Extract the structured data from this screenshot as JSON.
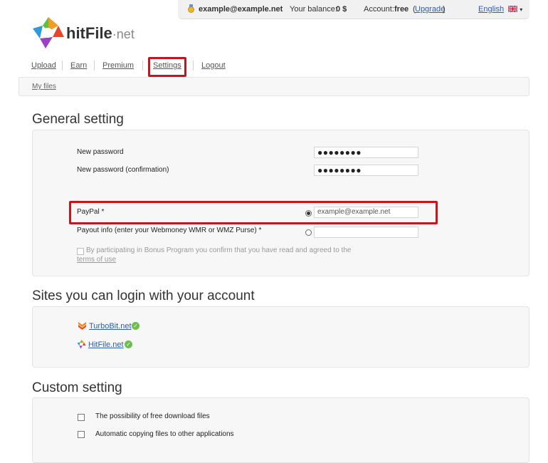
{
  "topbar": {
    "email": "example@example.net",
    "balance_label": "Your balance:",
    "balance_value": "0 $",
    "account_label": "Account:",
    "account_value": "free",
    "upgrade_prefix": "(",
    "upgrade_link": "Upgrade",
    "upgrade_suffix": ")",
    "language": "English",
    "colors": {
      "bar_bg": "#f1f1f1"
    }
  },
  "logo": {
    "text_a": "hit",
    "text_b": "File",
    "text_c": "·net"
  },
  "nav": {
    "items": [
      "Upload",
      "Earn",
      "Premium",
      "Settings",
      "Logout"
    ],
    "highlight_color": "#c4161c"
  },
  "breadcrumb": {
    "label": "My files"
  },
  "general": {
    "title": "General setting",
    "new_password_label": "New password",
    "new_password_value": "●●●●●●●●",
    "confirm_password_label": "New password (confirmation)",
    "confirm_password_value": "●●●●●●●●",
    "paypal_label": "PayPal *",
    "paypal_value": "example@example.net",
    "payout_label": "Payout info (enter your Webmoney WMR or WMZ Purse) *",
    "payout_value": "",
    "bonus_text": "By participating in Bonus Program you confirm that you have read and agreed to the",
    "terms_link": "terms of use"
  },
  "sites": {
    "title": "Sites you can login with your account",
    "items": [
      "TurboBit.net",
      "HitFile.net"
    ],
    "check_color": "#6bbf4e"
  },
  "custom": {
    "title": "Custom setting",
    "options": [
      "The possibility of free download files",
      "Automatic copying files to other applications"
    ]
  }
}
